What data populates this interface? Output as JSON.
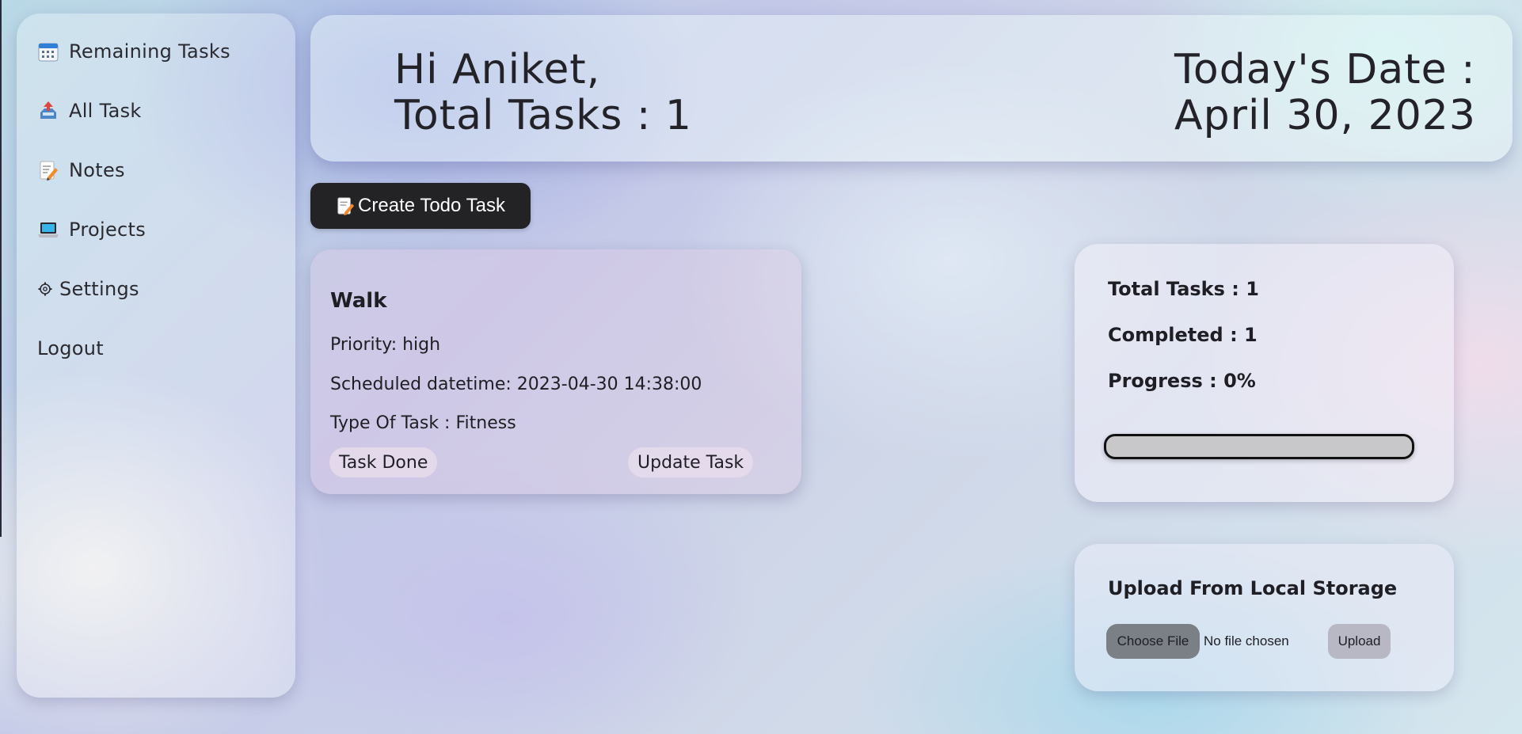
{
  "sidebar": {
    "items": [
      {
        "label": "Remaining Tasks",
        "icon": "calendar-icon"
      },
      {
        "label": "All Task",
        "icon": "inbox-tray-icon"
      },
      {
        "label": "Notes",
        "icon": "memo-icon"
      },
      {
        "label": "Projects",
        "icon": "laptop-icon"
      },
      {
        "label": "Settings",
        "icon": "gear-icon"
      },
      {
        "label": "Logout",
        "icon": ""
      }
    ]
  },
  "header": {
    "greeting": "Hi Aniket,",
    "total_tasks": "Total Tasks : 1",
    "date_label": "Today's Date :",
    "date_value": "April 30, 2023"
  },
  "create_button": {
    "label": "Create Todo Task",
    "icon": "memo-icon"
  },
  "task": {
    "title": "Walk",
    "priority": "Priority: high",
    "scheduled": "Scheduled datetime: 2023-04-30 14:38:00",
    "type": "Type Of Task : Fitness",
    "done_label": "Task Done",
    "update_label": "Update Task"
  },
  "stats": {
    "total": "Total Tasks : 1",
    "completed": "Completed : 1",
    "progress": "Progress : 0%",
    "progress_percent": 0
  },
  "upload": {
    "title": "Upload From Local Storage",
    "choose_label": "Choose File",
    "file_status": "No file chosen",
    "upload_label": "Upload"
  }
}
